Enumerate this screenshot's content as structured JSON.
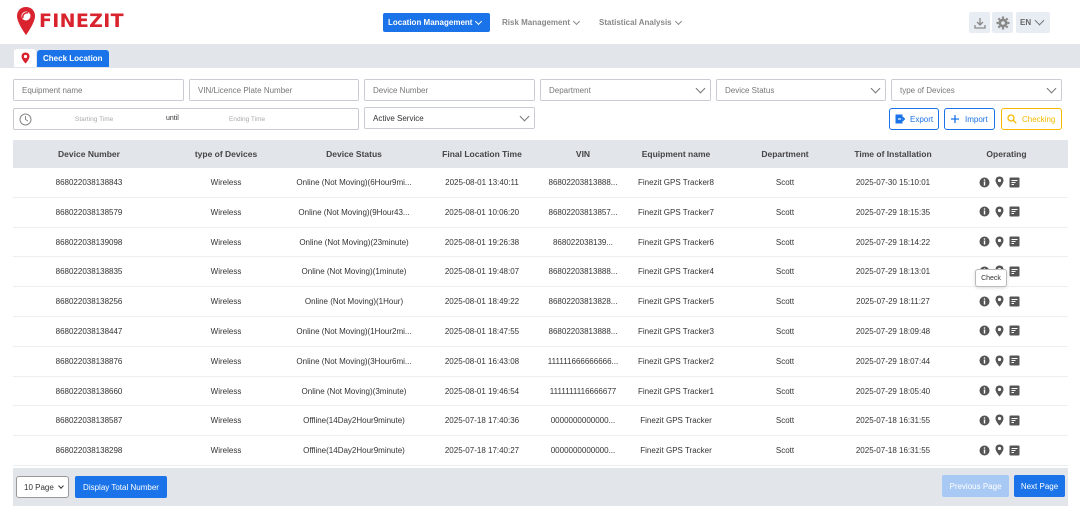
{
  "brand": {
    "name": "FINEZIT",
    "color": "#d9232e"
  },
  "nav": [
    {
      "label": "Location Management",
      "active": true
    },
    {
      "label": "Risk Management",
      "active": false
    },
    {
      "label": "Statistical Analysis",
      "active": false
    }
  ],
  "header": {
    "download_icon": "download-icon",
    "settings_icon": "gear-icon",
    "lang": "EN"
  },
  "tabs": {
    "active_label": "Check Location",
    "pin_icon": "location-pin-icon"
  },
  "filters": {
    "equipment_name": "Equipment name",
    "vin": "VIN/Licence Plate Number",
    "device_number": "Device Number",
    "department": "Department",
    "device_status": "Device Status",
    "type_of_devices": "type of Devices",
    "starting_time": "Starting Time",
    "until": "until",
    "ending_time": "Ending Time",
    "service": "Active Service"
  },
  "actions": {
    "export": "Export",
    "import": "Import",
    "checking": "Checking"
  },
  "table": {
    "headers": [
      "Device Number",
      "type of Devices",
      "Device Status",
      "Final Location Time",
      "VIN",
      "Equipment name",
      "Department",
      "Time of Installation",
      "Operating"
    ],
    "rows": [
      [
        "868022038138843",
        "Wireless",
        "Online (Not Moving)(6Hour9mi...",
        "2025-08-01 13:40:11",
        "86802203813888...",
        "Finezit GPS Tracker8",
        "Scott",
        "2025-07-30 15:10:01"
      ],
      [
        "868022038138579",
        "Wireless",
        "Online (Not Moving)(9Hour43...",
        "2025-08-01 10:06:20",
        "86802203813857...",
        "Finezit GPS Tracker7",
        "Scott",
        "2025-07-29 18:15:35"
      ],
      [
        "868022038139098",
        "Wireless",
        "Online (Not Moving)(23minute)",
        "2025-08-01 19:26:38",
        "868022038139...",
        "Finezit GPS Tracker6",
        "Scott",
        "2025-07-29 18:14:22"
      ],
      [
        "868022038138835",
        "Wireless",
        "Online (Not Moving)(1minute)",
        "2025-08-01 19:48:07",
        "86802203813888...",
        "Finezit GPS Tracker4",
        "Scott",
        "2025-07-29 18:13:01"
      ],
      [
        "868022038138256",
        "Wireless",
        "Online (Not Moving)(1Hour)",
        "2025-08-01 18:49:22",
        "86802203813828...",
        "Finezit GPS Tracker5",
        "Scott",
        "2025-07-29 18:11:27"
      ],
      [
        "868022038138447",
        "Wireless",
        "Online (Not Moving)(1Hour2mi...",
        "2025-08-01 18:47:55",
        "86802203813888...",
        "Finezit GPS Tracker3",
        "Scott",
        "2025-07-29 18:09:48"
      ],
      [
        "868022038138876",
        "Wireless",
        "Online (Not Moving)(3Hour6mi...",
        "2025-08-01 16:43:08",
        "111111666666666...",
        "Finezit GPS Tracker2",
        "Scott",
        "2025-07-29 18:07:44"
      ],
      [
        "868022038138660",
        "Wireless",
        "Online (Not Moving)(3minute)",
        "2025-08-01 19:46:54",
        "1111111116666677",
        "Finezit GPS Tracker1",
        "Scott",
        "2025-07-29 18:05:40"
      ],
      [
        "868022038138587",
        "Wireless",
        "Offline(14Day2Hour9minute)",
        "2025-07-18 17:40:36",
        "0000000000000...",
        "Finezit GPS Tracker",
        "Scott",
        "2025-07-18 16:31:55"
      ],
      [
        "868022038138298",
        "Wireless",
        "Offline(14Day2Hour9minute)",
        "2025-07-18 17:40:27",
        "0000000000000...",
        "Finezit GPS Tracker",
        "Scott",
        "2025-07-18 16:31:55"
      ]
    ],
    "row_icons": [
      "info-icon",
      "location-pin-icon",
      "track-icon"
    ]
  },
  "tooltip": "Check",
  "footer": {
    "page_size": "10 Page",
    "total_label": "Display Total Number",
    "prev": "Previous Page",
    "next": "Next Page"
  },
  "colors": {
    "primary": "#1a73e8",
    "warning": "#f5b800",
    "header_bg": "#e2e5ea"
  }
}
